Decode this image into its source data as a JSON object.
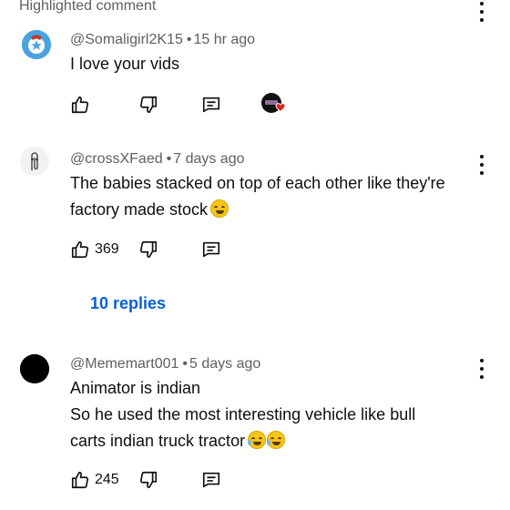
{
  "header": {
    "label": "Highlighted comment"
  },
  "comments": [
    {
      "handle": "@Somaligirl2K15",
      "age": "15 hr ago",
      "lines": [
        "I love your vids"
      ],
      "likes": "",
      "avatar_icon": "somali-star-flag-avatar-icon",
      "creator_heart": true
    },
    {
      "handle": "@crossXFaed",
      "age": "7 days ago",
      "lines": [
        "The babies stacked on top of each other like they're",
        "factory made stock"
      ],
      "likes": "369",
      "avatar_icon": "paperclip-avatar-icon",
      "replies": "10 replies"
    },
    {
      "handle": "@Mememart001",
      "age": "5 days ago",
      "lines": [
        "Animator is indian",
        "So he used the most interesting vehicle like bull",
        "carts indian truck tractor"
      ],
      "likes": "245",
      "avatar_icon": "black-circle-avatar-icon"
    }
  ],
  "colors": {
    "link": "#065fd4",
    "meta": "#606060",
    "text": "#0f0f0f",
    "heart": "#e62117"
  }
}
